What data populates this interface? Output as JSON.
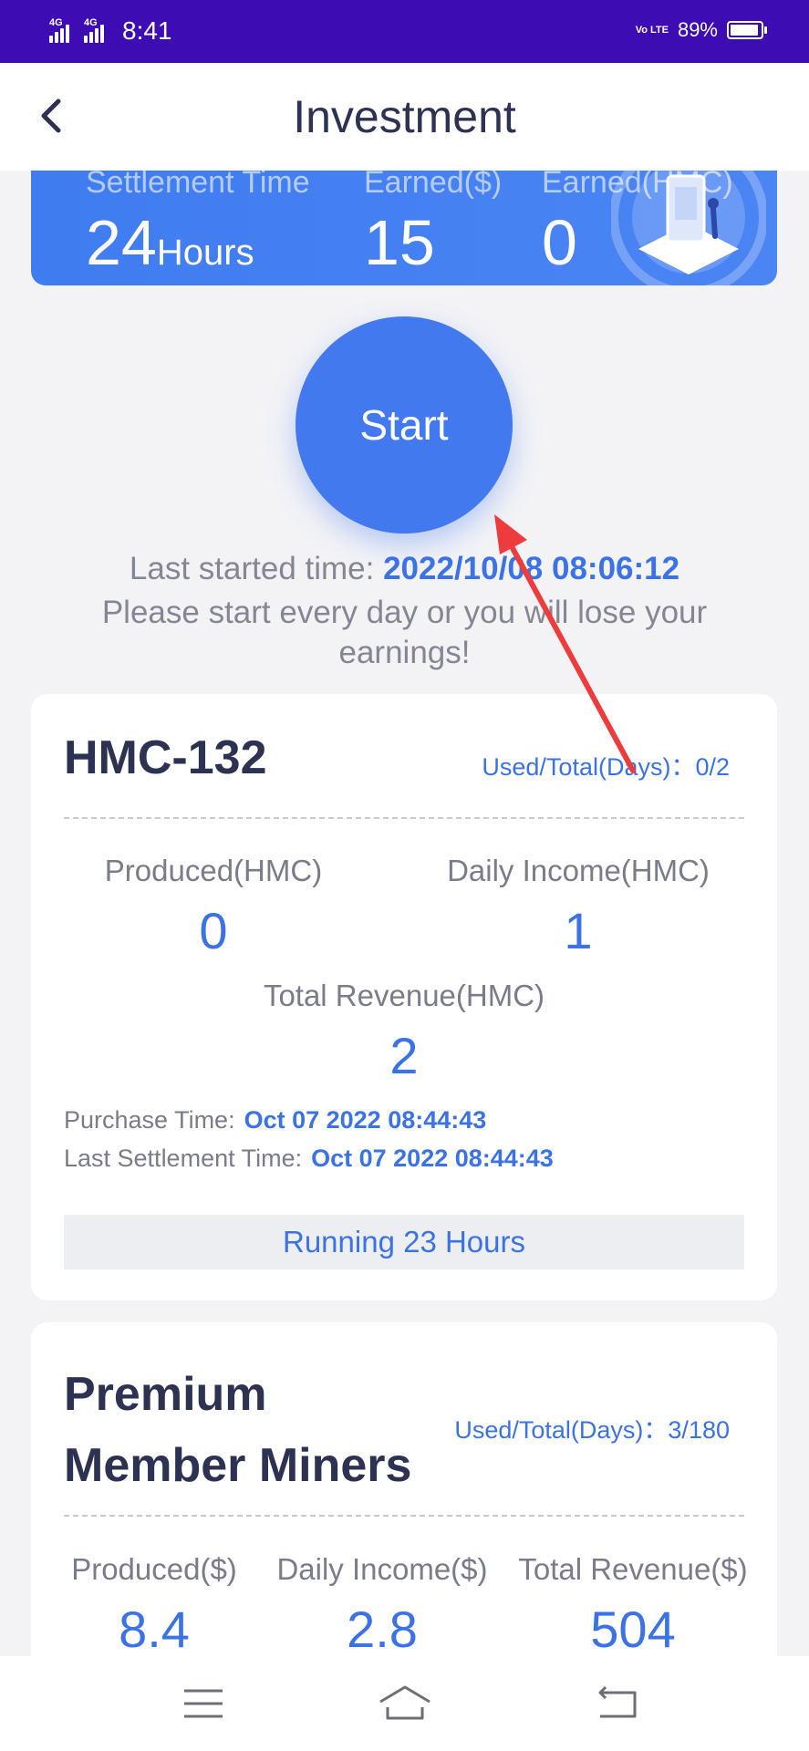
{
  "status_bar": {
    "network_1": "4G",
    "network_2": "4G",
    "time": "8:41",
    "volte": "Vo LTE",
    "battery": "89%"
  },
  "header": {
    "title": "Investment",
    "back_icon": "chevron-left-icon"
  },
  "banner": {
    "settlement_label": "Settlement Time",
    "settlement_value": "24",
    "settlement_unit": "Hours",
    "earned_usd_label": "Earned($)",
    "earned_usd_value": "15",
    "earned_hmc_label": "Earned(HMC)",
    "earned_hmc_value": "0"
  },
  "start_button": {
    "label": "Start"
  },
  "last_started": {
    "label": "Last started time:",
    "value": "2022/10/08 08:06:12"
  },
  "warning": "Please start every day or you will lose your earnings!",
  "card_1": {
    "title": "HMC-132",
    "used_total": "Used/Total(Days)：0/2",
    "produced_label": "Produced(HMC)",
    "produced_value": "0",
    "daily_income_label": "Daily Income(HMC)",
    "daily_income_value": "1",
    "total_revenue_label": "Total Revenue(HMC)",
    "total_revenue_value": "2",
    "purchase_time_label": "Purchase Time:",
    "purchase_time_value": "Oct 07 2022 08:44:43",
    "last_settlement_label": "Last Settlement Time:",
    "last_settlement_value": "Oct 07 2022 08:44:43",
    "running": "Running 23 Hours"
  },
  "card_2": {
    "title": "Premium Member Miners",
    "used_total": "Used/Total(Days)：3/180",
    "produced_label": "Produced($)",
    "produced_value": "8.4",
    "daily_income_label": "Daily Income($)",
    "daily_income_value": "2.8",
    "total_revenue_label": "Total Revenue($)",
    "total_revenue_value": "504"
  },
  "bottom_nav": {
    "menu_icon": "menu-icon",
    "home_icon": "home-icon",
    "back_icon": "back-icon"
  },
  "colors": {
    "status_bar": "#3d0cb3",
    "accent_blue": "#4279ef",
    "value_blue": "#3b72e6",
    "title_dark": "#2e3252",
    "annotation_red": "#ee3b3b"
  }
}
